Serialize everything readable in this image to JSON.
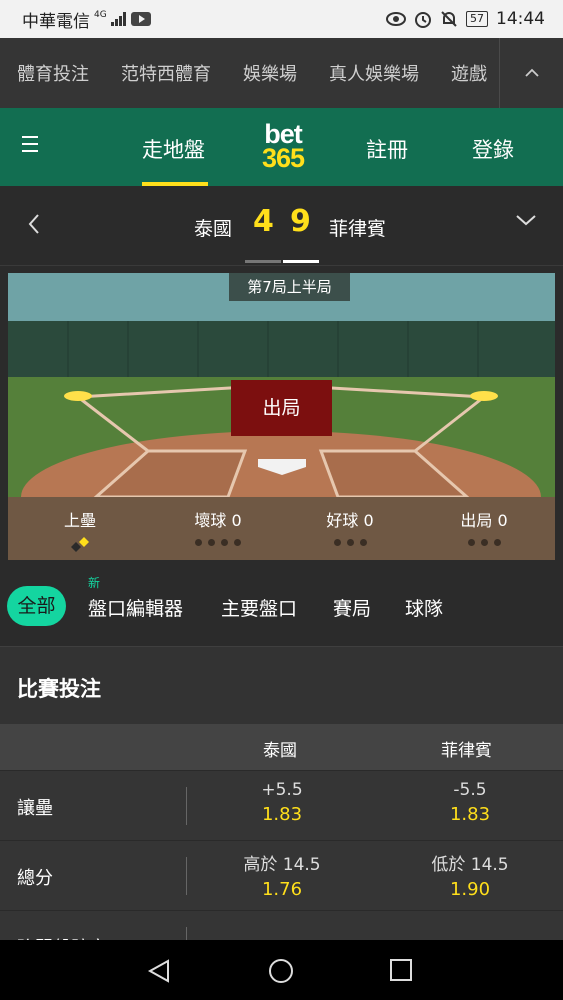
{
  "status_bar": {
    "carrier": "中華電信",
    "network": "4G",
    "battery": "57",
    "time": "14:44"
  },
  "top_nav": {
    "items": [
      "體育投注",
      "范特西體育",
      "娛樂場",
      "真人娛樂場",
      "遊戲"
    ]
  },
  "brand_bar": {
    "live_label": "走地盤",
    "logo_top": "bet",
    "logo_bottom": "365",
    "register_label": "註冊",
    "login_label": "登錄"
  },
  "scoreboard": {
    "home_team": "泰國",
    "home_score": "4",
    "away_score": "9",
    "away_team": "菲律賓"
  },
  "field": {
    "inning": "第7局上半局",
    "status": "出局",
    "bases_label": "上壘",
    "balls_label": "壞球 0",
    "strikes_label": "好球 0",
    "outs_label": "出局 0"
  },
  "filter_tabs": {
    "new_badge": "新",
    "items": [
      "全部",
      "盤口編輯器",
      "主要盤口",
      "賽局",
      "球隊"
    ]
  },
  "match_betting": {
    "title": "比賽投注",
    "columns": [
      "泰國",
      "菲律賓"
    ],
    "rows": [
      {
        "label": "讓壘",
        "home_line": "+5.5",
        "home_odds": "1.83",
        "away_line": "-5.5",
        "away_odds": "1.83"
      },
      {
        "label": "總分",
        "home_line": "高於 14.5",
        "home_odds": "1.76",
        "away_line": "低於 14.5",
        "away_odds": "1.90"
      },
      {
        "label": "強弱盤賠率",
        "home_line": "",
        "home_odds": "",
        "away_line": "",
        "away_odds": ""
      }
    ]
  },
  "colors": {
    "brand_green": "#126e51",
    "accent_yellow": "#ffdf1b",
    "tab_active": "#14d5a0",
    "out_red": "#7c0f0f"
  }
}
